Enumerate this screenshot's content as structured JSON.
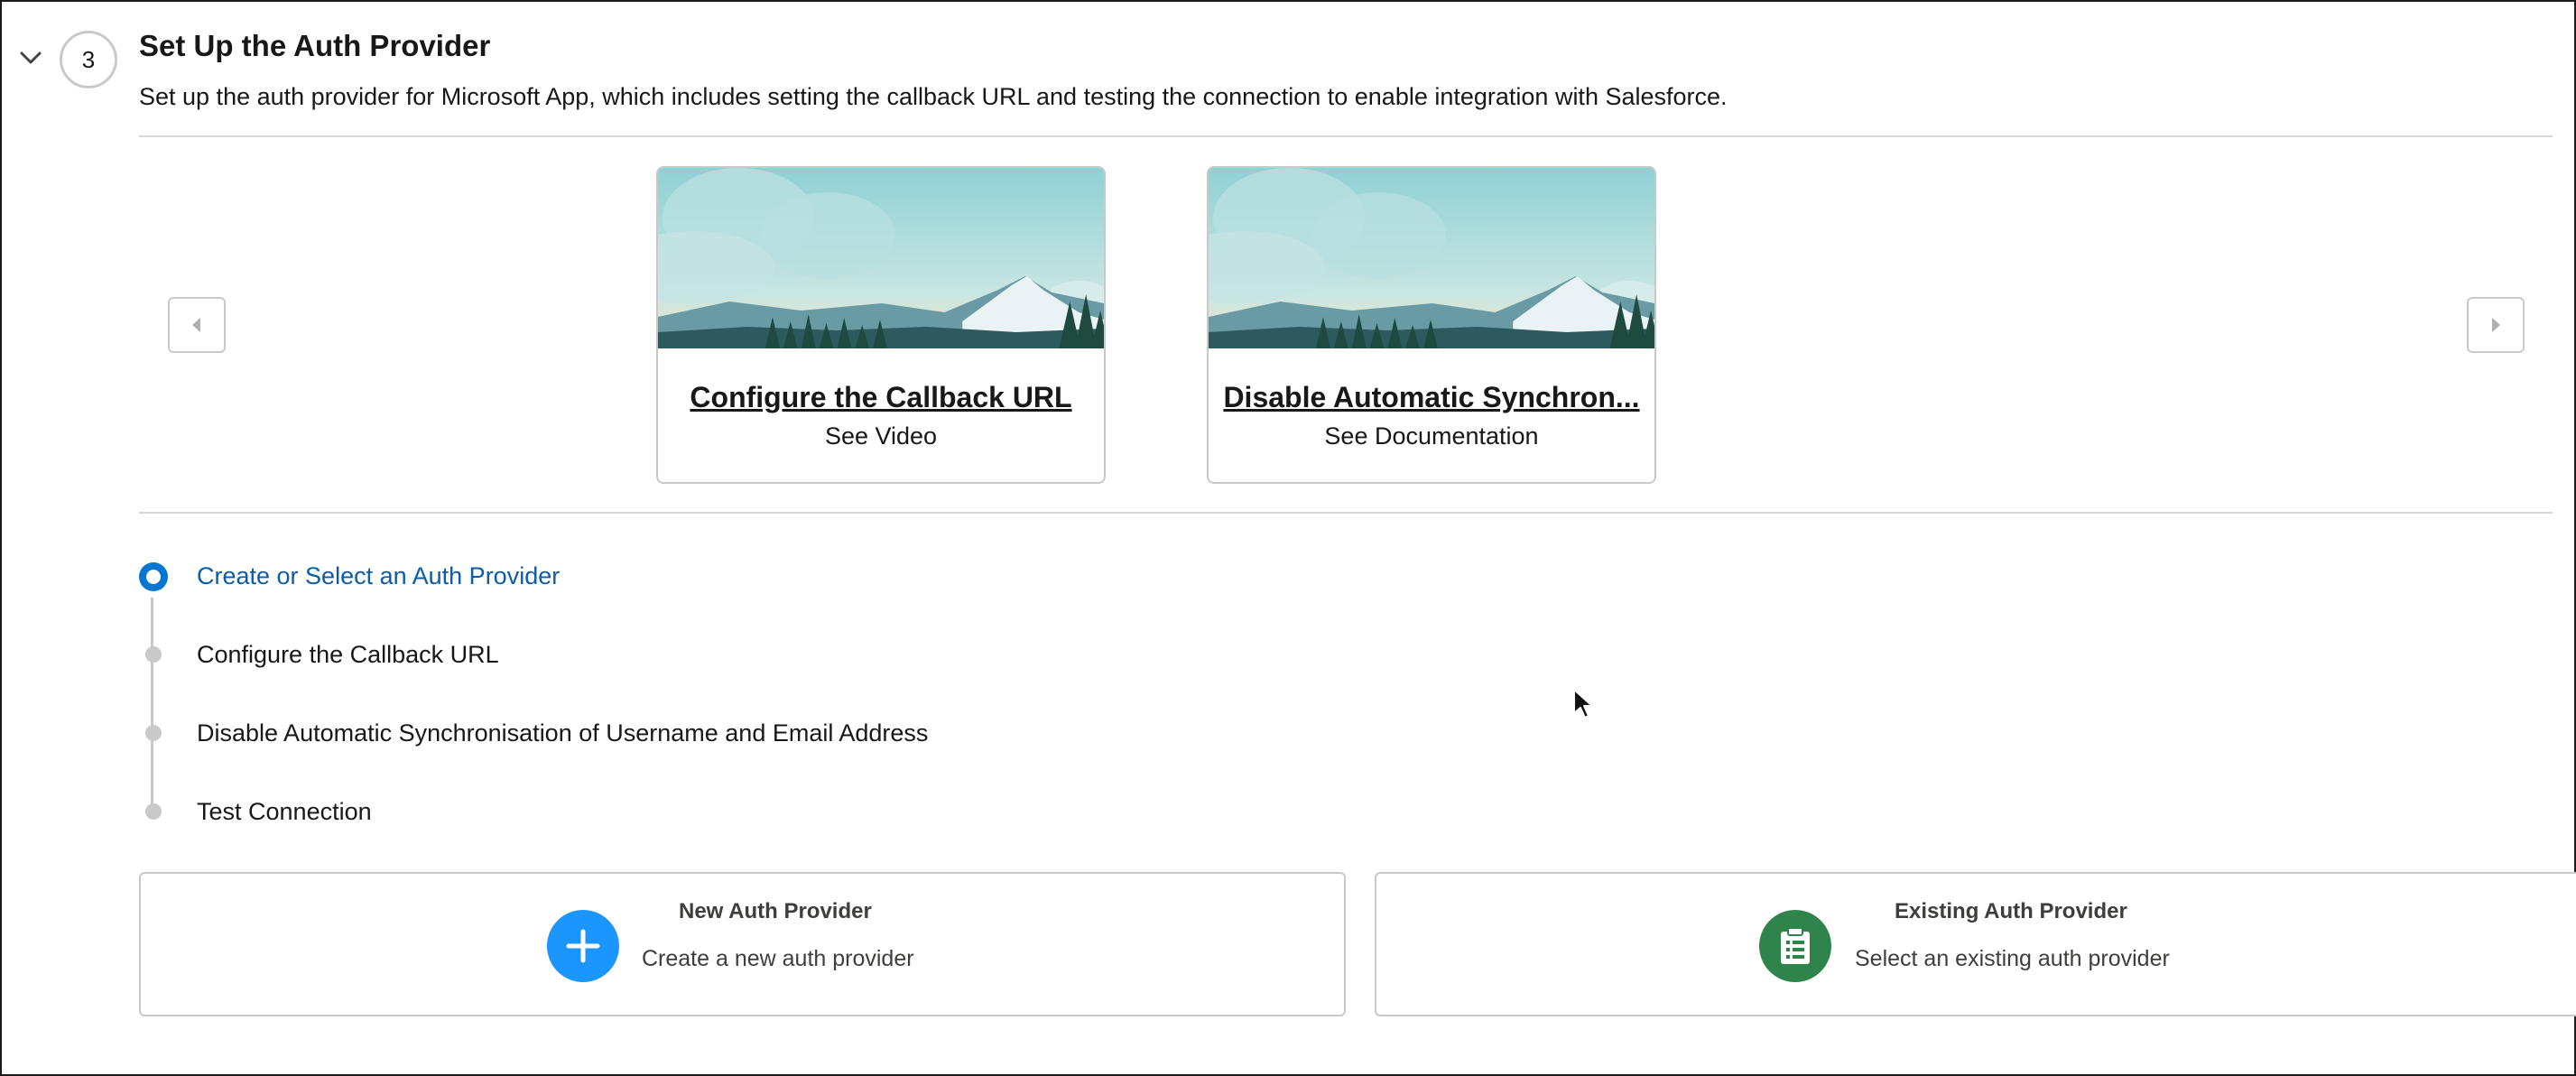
{
  "section": {
    "step_number": "3",
    "title": "Set Up the Auth Provider",
    "description": "Set up the auth provider for Microsoft App, which includes setting the callback URL and testing the connection to enable integration with Salesforce."
  },
  "carousel": {
    "cards": [
      {
        "title": "Configure the Callback URL",
        "subtitle": "See Video"
      },
      {
        "title": "Disable Automatic Synchron...",
        "subtitle": "See Documentation"
      }
    ]
  },
  "steps": [
    {
      "label": "Create or Select an Auth Provider",
      "active": true
    },
    {
      "label": "Configure the Callback URL",
      "active": false
    },
    {
      "label": "Disable Automatic Synchronisation of Username and Email Address",
      "active": false
    },
    {
      "label": "Test Connection",
      "active": false
    }
  ],
  "options": [
    {
      "title": "New Auth Provider",
      "description": "Create a new auth provider",
      "icon": "add-icon",
      "color": "#1b96ff"
    },
    {
      "title": "Existing Auth Provider",
      "description": "Select an existing auth provider",
      "icon": "clipboard-list-icon",
      "color": "#2e844a"
    }
  ],
  "colors": {
    "accent": "#0176d3",
    "active_step_text": "#0b5cab",
    "border": "#c9c9c9"
  }
}
